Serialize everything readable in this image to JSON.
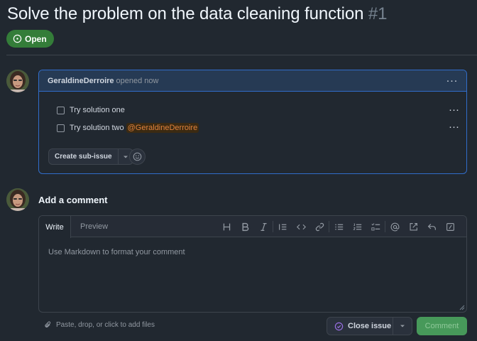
{
  "issue": {
    "title": "Solve the problem on the data cleaning function",
    "number": "#1",
    "state": "Open"
  },
  "comment": {
    "author": "GeraldineDerroire",
    "meta": "opened now",
    "tasks": [
      {
        "text": "Try solution one",
        "checked": false
      },
      {
        "text": "Try solution two",
        "mention": "@GeraldineDerroire",
        "checked": false
      }
    ],
    "sub_issue_label": "Create sub-issue"
  },
  "new_comment": {
    "heading": "Add a comment",
    "tabs": [
      "Write",
      "Preview"
    ],
    "active_tab": "Write",
    "placeholder": "Use Markdown to format your comment",
    "toolbar_icons": [
      "heading-icon",
      "bold-icon",
      "italic-icon",
      "quote-icon",
      "code-icon",
      "link-icon",
      "unordered-list-icon",
      "ordered-list-icon",
      "task-list-icon",
      "mention-icon",
      "reference-icon",
      "reply-icon",
      "slash-command-icon"
    ],
    "attach_hint": "Paste, drop, or click to add files",
    "close_label": "Close issue",
    "submit_label": "Comment"
  },
  "colors": {
    "background": "#212830",
    "open_badge": "#347d39",
    "accent_border": "#316dca",
    "mention": "#e0823d",
    "close_icon": "#986ee2",
    "comment_button": "#47995a"
  }
}
